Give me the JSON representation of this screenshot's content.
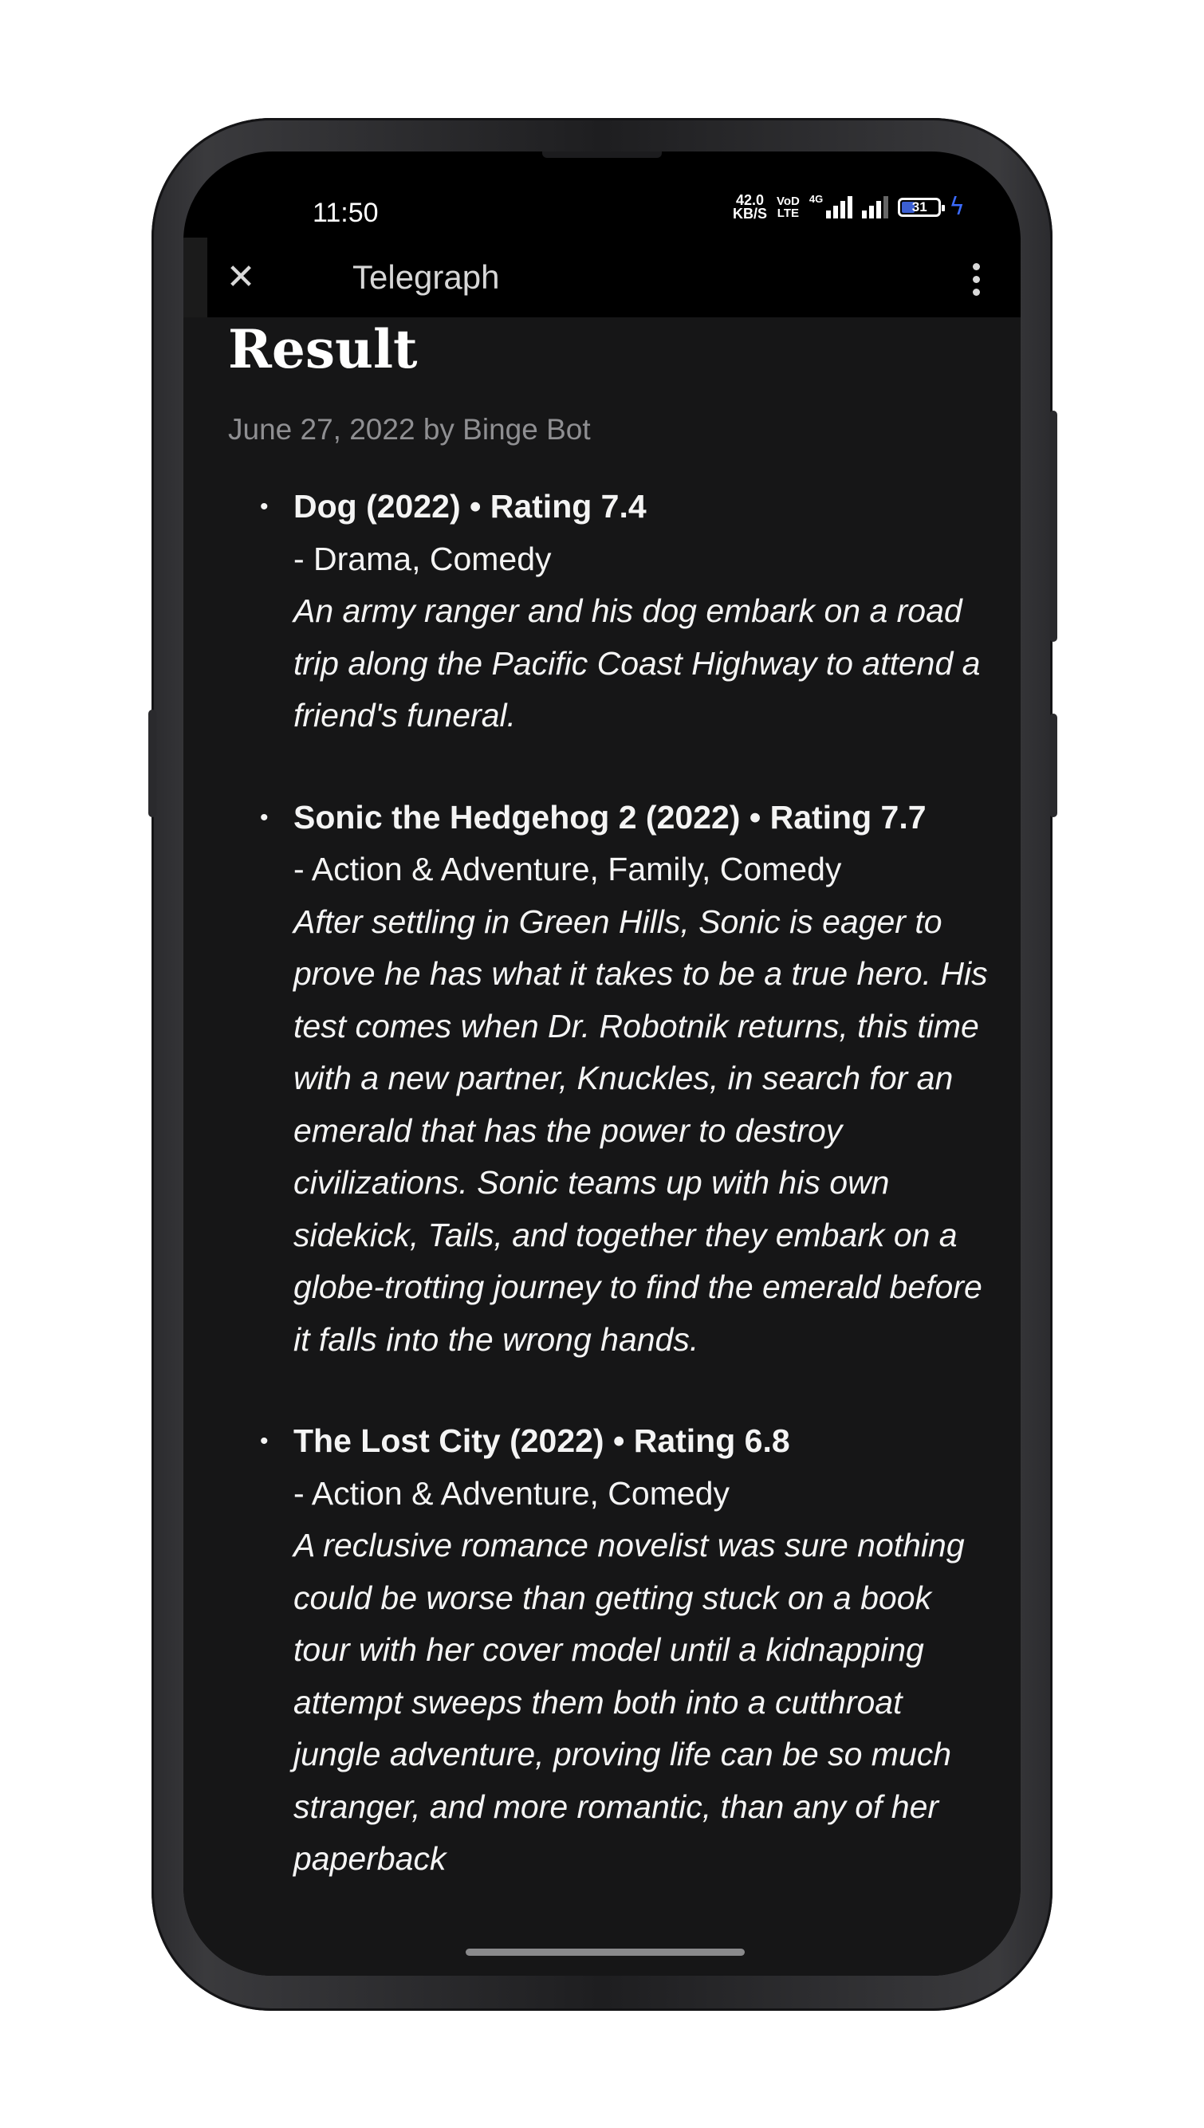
{
  "status_bar": {
    "time": "11:50",
    "net_speed_value": "42.0",
    "net_speed_unit": "KB/S",
    "volte_top": "VoD",
    "volte_bottom": "LTE",
    "network_type": "4G",
    "battery_level": "31",
    "charging": true,
    "battery_fill_color": "#3c5fd1",
    "bolt_color": "#3b6bff"
  },
  "app_bar": {
    "title": "Telegraph",
    "close_icon": "close-icon",
    "menu_icon": "more-vertical-icon"
  },
  "article": {
    "title": "Result",
    "byline": "June 27, 2022 by Binge Bot",
    "items": [
      {
        "heading": "Dog (2022) • Rating 7.4",
        "genres": "- Drama, Comedy",
        "description": "An army ranger and his dog embark on a road trip along the Pacific Coast Highway to attend a friend's funeral."
      },
      {
        "heading": "Sonic the Hedgehog 2 (2022) • Rating 7.7",
        "genres": "- Action & Adventure, Family, Comedy",
        "description": "After settling in Green Hills, Sonic is eager to prove he has what it takes to be a true hero. His test comes when Dr. Robotnik returns, this time with a new partner, Knuckles, in search for an emerald that has the power to destroy civilizations. Sonic teams up with his own sidekick, Tails, and together they embark on a globe-trotting journey to find the emerald before it falls into the wrong hands."
      },
      {
        "heading": "The Lost City (2022) • Rating 6.8",
        "genres": "- Action & Adventure, Comedy",
        "description": "A reclusive romance novelist was sure nothing could be worse than getting stuck on a book tour with her cover model until a kidnapping attempt sweeps them both into a cutthroat jungle adventure, proving life can be so much stranger, and more romantic, than any of her paperback"
      }
    ]
  }
}
